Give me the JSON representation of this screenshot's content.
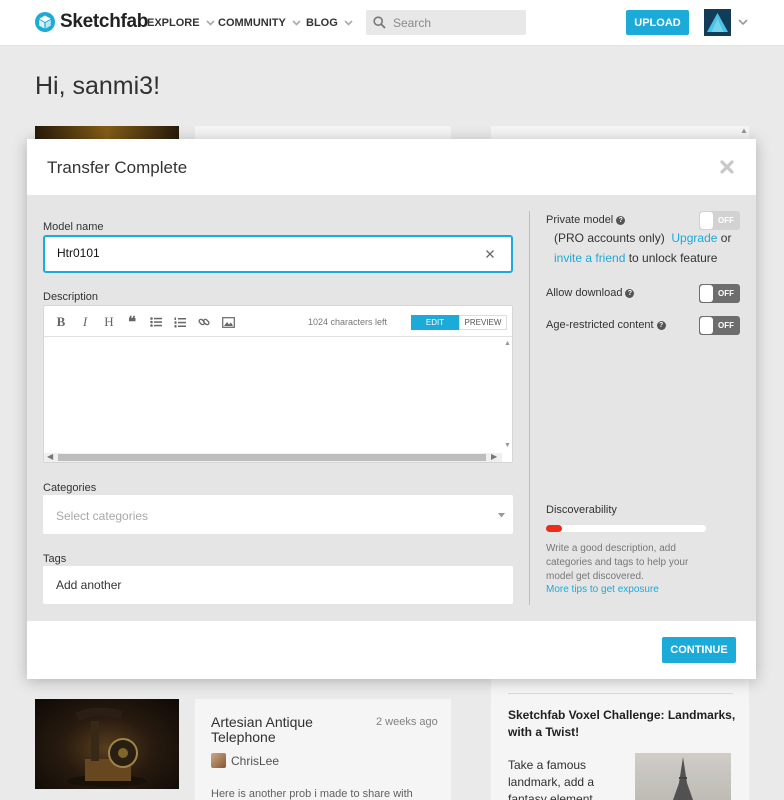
{
  "header": {
    "logo_text": "Sketchfab",
    "nav": [
      {
        "label": "EXPLORE"
      },
      {
        "label": "COMMUNITY"
      },
      {
        "label": "BLOG"
      }
    ],
    "search_placeholder": "Search",
    "upload_label": "UPLOAD",
    "brand_color": "#1caad9"
  },
  "page": {
    "greeting": "Hi, sanmi3!",
    "card": {
      "title": "Artesian Antique Telephone",
      "time": "2 weeks ago",
      "user": "ChrisLee",
      "text": "Here is another prob i made to share with"
    },
    "side": {
      "title": "Sketchfab Voxel Challenge: Landmarks, with a Twist!",
      "text": "Take a famous landmark, add a fantasy element to it,"
    }
  },
  "modal": {
    "title": "Transfer Complete",
    "model_name_label": "Model name",
    "model_name_value": "Htr0101",
    "description_label": "Description",
    "chars_left": "1024 characters left",
    "edit_label": "EDIT",
    "preview_label": "PREVIEW",
    "toolbar_icons": [
      "bold-icon",
      "italic-icon",
      "heading-icon",
      "quote-icon",
      "bullet-list-icon",
      "numbered-list-icon",
      "link-icon",
      "image-icon"
    ],
    "categories_label": "Categories",
    "categories_placeholder": "Select categories",
    "tags_label": "Tags",
    "tags_placeholder": "Add another",
    "private_model_label": "Private model",
    "private_note_a": "(PRO accounts only)",
    "upgrade_link": "Upgrade",
    "or_text": "or",
    "invite_link": "invite a friend",
    "unlock_text": "to unlock feature",
    "allow_download_label": "Allow download",
    "age_restricted_label": "Age-restricted content",
    "toggle_off": "OFF",
    "toggles": {
      "private_model": false,
      "allow_download": false,
      "age_restricted": false
    },
    "discoverability_label": "Discoverability",
    "discoverability_level": 0.1,
    "discoverability_color": "#ee2a1a",
    "discoverability_help": "Write a good description, add categories and tags to help your model get discovered.",
    "discoverability_link": "More tips to get exposure",
    "continue_label": "CONTINUE"
  }
}
